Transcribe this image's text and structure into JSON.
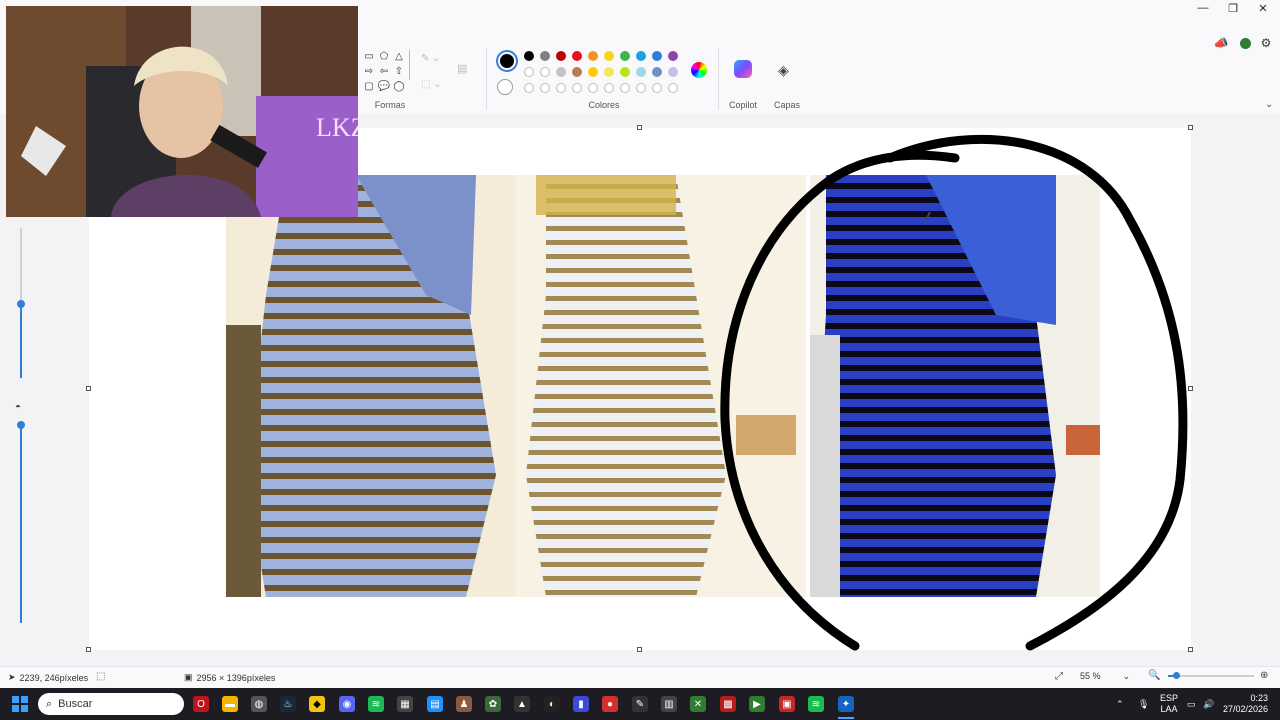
{
  "ribbon": {
    "shapes_label": "Formas",
    "colors_label": "Colores",
    "copilot_label": "Copilot",
    "layers_label": "Capas"
  },
  "palette": {
    "row1": [
      "#000000",
      "#7f7f7f",
      "#c00000",
      "#e81123",
      "#f7931e",
      "#f7d417",
      "#3cb54a",
      "#1ba1e2",
      "#2d7fd6",
      "#8e44ad"
    ],
    "row2": [
      "#ffffff",
      "#c3c3c3",
      "#b97a57",
      "#ffc90e",
      "#f5e85c",
      "#b5e61d",
      "#99d9ea",
      "#7092be",
      "#c8bfe7"
    ],
    "row3_empty_count": 10
  },
  "status": {
    "cursor_position": "2239, 246píxeles",
    "image_size": "2956 × 1396píxeles",
    "zoom": "55 %"
  },
  "taskbar": {
    "search_placeholder": "Buscar",
    "lang_top": "ESP",
    "lang_bottom": "LAA",
    "time": "0:23",
    "date": "27/02/2026"
  },
  "webcam": {
    "sign_text": "LKZ"
  }
}
